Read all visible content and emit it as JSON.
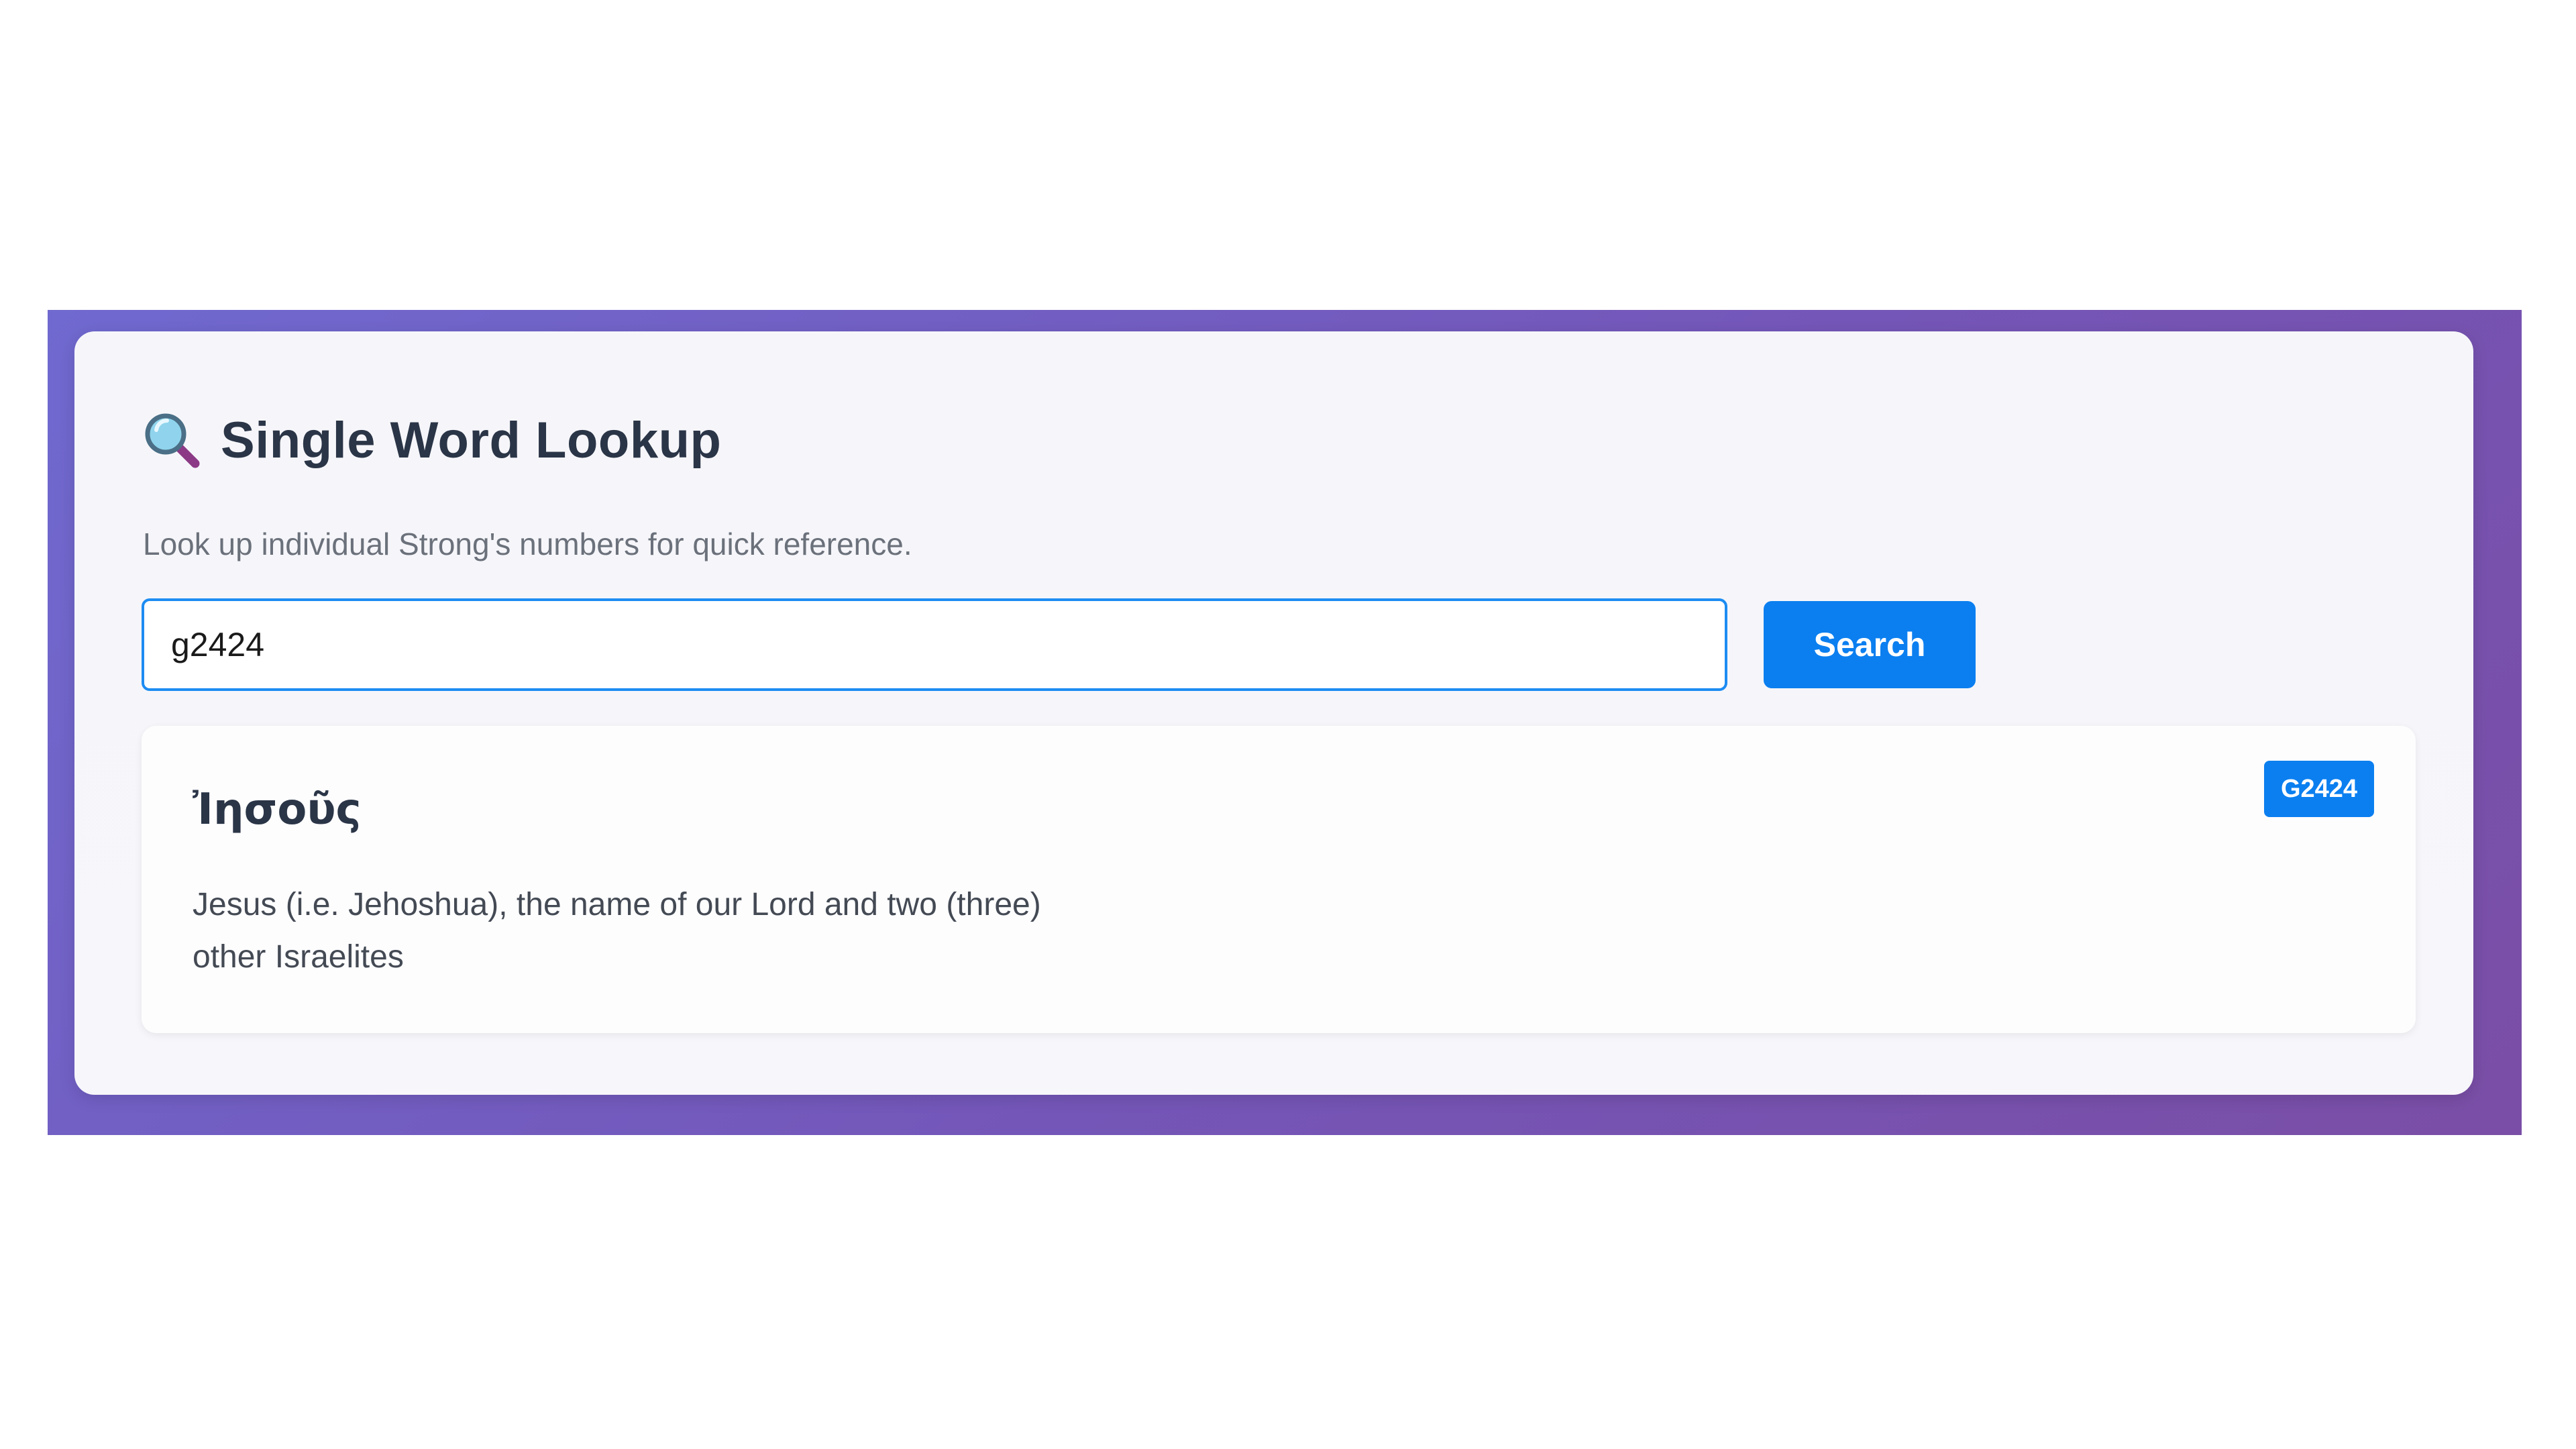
{
  "header": {
    "icon": "magnifying-glass-icon",
    "title": "Single Word Lookup",
    "subtitle": "Look up individual Strong's numbers for quick reference."
  },
  "search": {
    "value": "g2424",
    "button_label": "Search"
  },
  "result": {
    "word": "Ἰησοῦς",
    "badge": "G2424",
    "definition": "Jesus (i.e. Jehoshua), the name of our Lord and two (three) other Israelites"
  },
  "colors": {
    "accent": "#0b7ff0",
    "frame_start": "#7069cf",
    "frame_end": "#7a4ea6",
    "title_text": "#2a3547"
  }
}
